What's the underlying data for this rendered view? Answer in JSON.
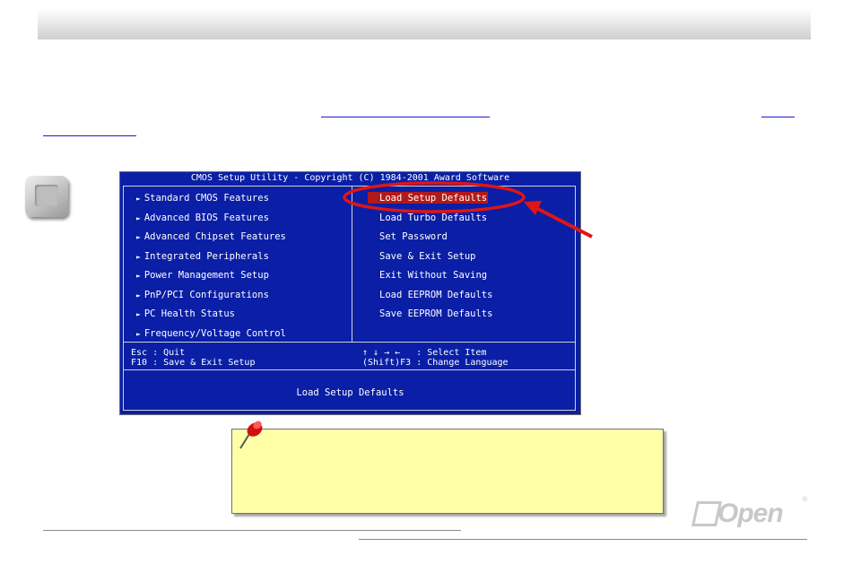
{
  "header": {
    "title": ""
  },
  "bios": {
    "title": "CMOS Setup Utility - Copyright (C) 1984-2001 Award Software",
    "left_menu": [
      "Standard CMOS Features",
      "Advanced BIOS Features",
      "Advanced Chipset Features",
      "Integrated Peripherals",
      "Power Management Setup",
      "PnP/PCI Configurations",
      "PC Health Status",
      "Frequency/Voltage Control"
    ],
    "right_menu": [
      "Load Setup Defaults",
      "Load Turbo Defaults",
      "Set Password",
      "Save & Exit Setup",
      "Exit Without Saving",
      "Load EEPROM Defaults",
      "Save EEPROM Defaults"
    ],
    "selected_item": "Load Setup Defaults",
    "help": {
      "esc": "Esc : Quit",
      "f10": "F10 : Save & Exit Setup",
      "select": "↑ ↓ → ←   : Select Item",
      "language": "(Shift)F3 : Change Language"
    },
    "status": "Load Setup Defaults",
    "arrow_glyph": "►"
  },
  "note": {
    "text": ""
  },
  "logo": {
    "text": "Open",
    "reg": "®"
  },
  "colors": {
    "bios_bg": "#0a1fa6",
    "highlight_ring": "#e01515",
    "note_bg": "#ffffa8"
  }
}
